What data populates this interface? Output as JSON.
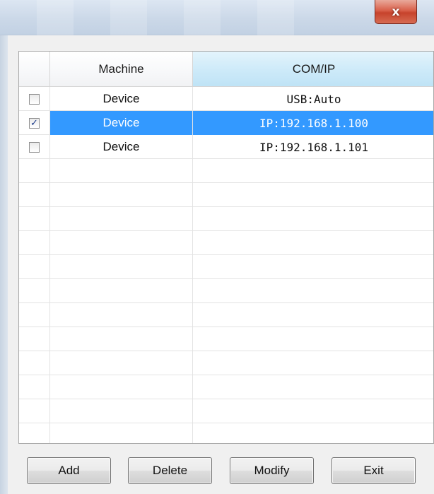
{
  "window": {
    "close_glyph": "x"
  },
  "grid": {
    "columns": [
      "Machine",
      "COM/IP"
    ],
    "rows": [
      {
        "checked": false,
        "machine": "Device",
        "com_ip": "USB:Auto",
        "selected": false
      },
      {
        "checked": true,
        "machine": "Device",
        "com_ip": "IP:192.168.1.100",
        "selected": true
      },
      {
        "checked": false,
        "machine": "Device",
        "com_ip": "IP:192.168.1.101",
        "selected": false
      }
    ],
    "selection_color": "#3399ff",
    "header_highlight_color": "#cdeaf9"
  },
  "buttons": {
    "add": "Add",
    "delete": "Delete",
    "modify": "Modify",
    "exit": "Exit"
  },
  "icons": {
    "close": "close-icon",
    "check": "checkmark-icon"
  }
}
